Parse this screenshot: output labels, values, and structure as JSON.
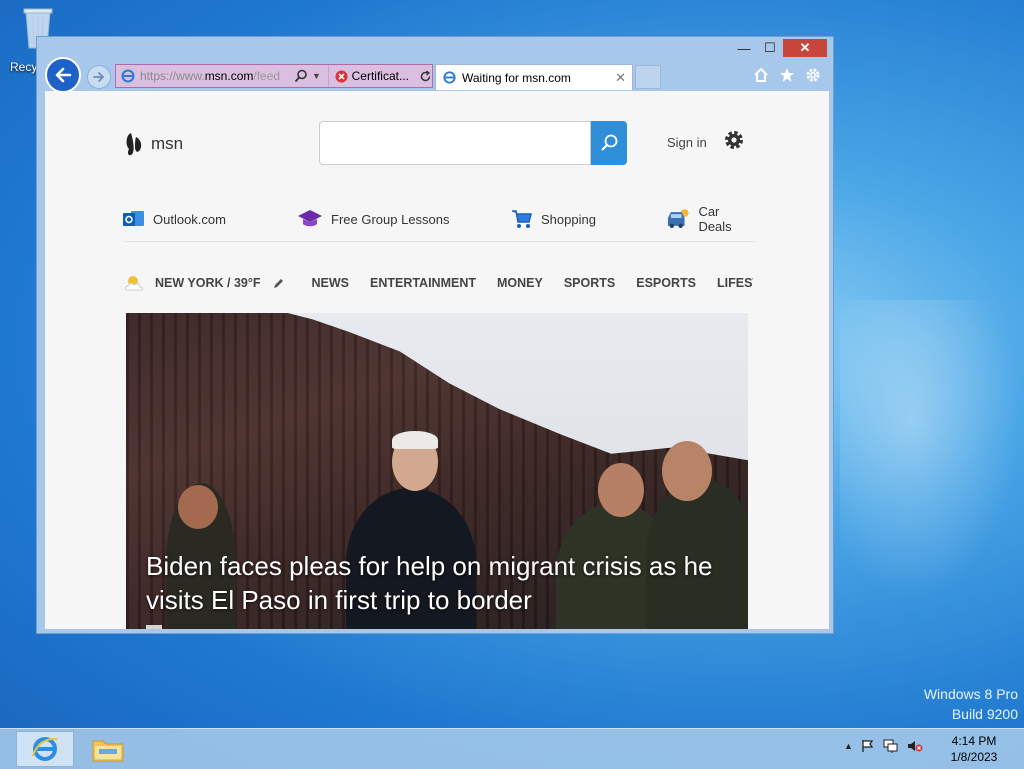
{
  "desktop": {
    "recycle_bin_label": "Recyc",
    "watermark_line1": "Windows 8 Pro",
    "watermark_line2": "Build 9200"
  },
  "browser": {
    "address": {
      "url_prefix": "https://www.",
      "url_host": "msn.com",
      "url_suffix": "/feed",
      "cert_error_label": "Certificat..."
    },
    "tab": {
      "title": "Waiting for msn.com",
      "close_glyph": "✕"
    },
    "caption": {
      "minimize": "—",
      "maximize": "☐",
      "close": "✕"
    }
  },
  "msn": {
    "logo_text": "msn",
    "search_placeholder": "",
    "sign_in": "Sign in",
    "quicklinks": [
      {
        "label": "Outlook.com",
        "icon": "outlook-icon"
      },
      {
        "label": "Free Group Lessons",
        "icon": "graduation-cap-icon"
      },
      {
        "label": "Shopping",
        "icon": "shopping-cart-icon"
      },
      {
        "label": "Car Deals",
        "icon": "car-icon"
      }
    ],
    "weather": "NEW YORK / 39°F",
    "nav": [
      "NEWS",
      "ENTERTAINMENT",
      "MONEY",
      "SPORTS",
      "ESPORTS",
      "LIFESTYLE"
    ],
    "hero": {
      "title": "Biden faces pleas for help on migrant crisis as he visits El Paso in first trip to border"
    }
  },
  "taskbar": {
    "time": "4:14 PM",
    "date": "1/8/2023"
  },
  "colors": {
    "ie_blue": "#1e62c8",
    "search_blue": "#2f8ed8",
    "close_red": "#c7453a",
    "address_error": "#dbbfe0"
  }
}
